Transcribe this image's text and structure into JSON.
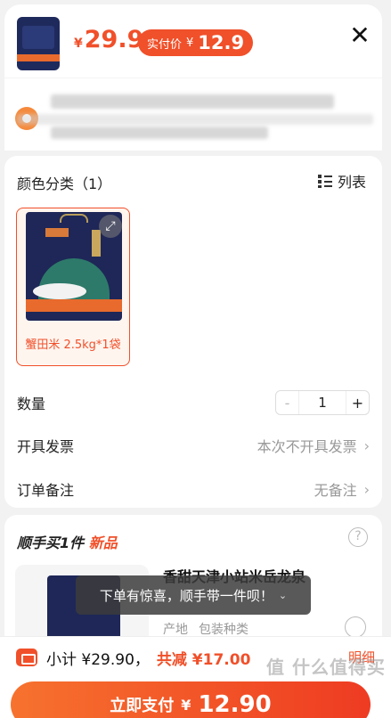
{
  "header": {
    "currency": "¥",
    "price": "29.9",
    "real_price_label": "实付价",
    "real_price": "12.9",
    "close_icon": "close-icon"
  },
  "address": {
    "icon": "location-pin-icon"
  },
  "spec": {
    "title": "颜色分类（1）",
    "list_label": "列表",
    "list_icon": "list-view-icon",
    "sku_label": "蟹田米 2.5kg*1袋",
    "expand_icon": "expand-icon"
  },
  "quantity": {
    "label": "数量",
    "minus": "-",
    "value": "1",
    "plus": "+"
  },
  "invoice": {
    "label": "开具发票",
    "value": "本次不开具发票"
  },
  "note": {
    "label": "订单备注",
    "value": "无备注"
  },
  "addon": {
    "title_prefix": "顺手买1件",
    "title_new": "新品",
    "help_icon": "help-icon",
    "product_name": "香甜天津小站米岳龙泉",
    "tags": [
      "产地",
      "包装种类"
    ]
  },
  "toast": {
    "text": "下单有惊喜，顺手带一件呗！",
    "chevron": "⌄"
  },
  "bottom": {
    "subtotal": "小计 ¥29.90，",
    "discount": "共减 ¥17.00",
    "detail": "明细",
    "pay_label": "立即支付",
    "pay_currency": "¥",
    "pay_amount": "12.90",
    "watermark": "值 什么值得买"
  },
  "colors": {
    "accent": "#f0502a",
    "pay_gradient_start": "#f7722e",
    "pay_gradient_end": "#ee3b22"
  }
}
